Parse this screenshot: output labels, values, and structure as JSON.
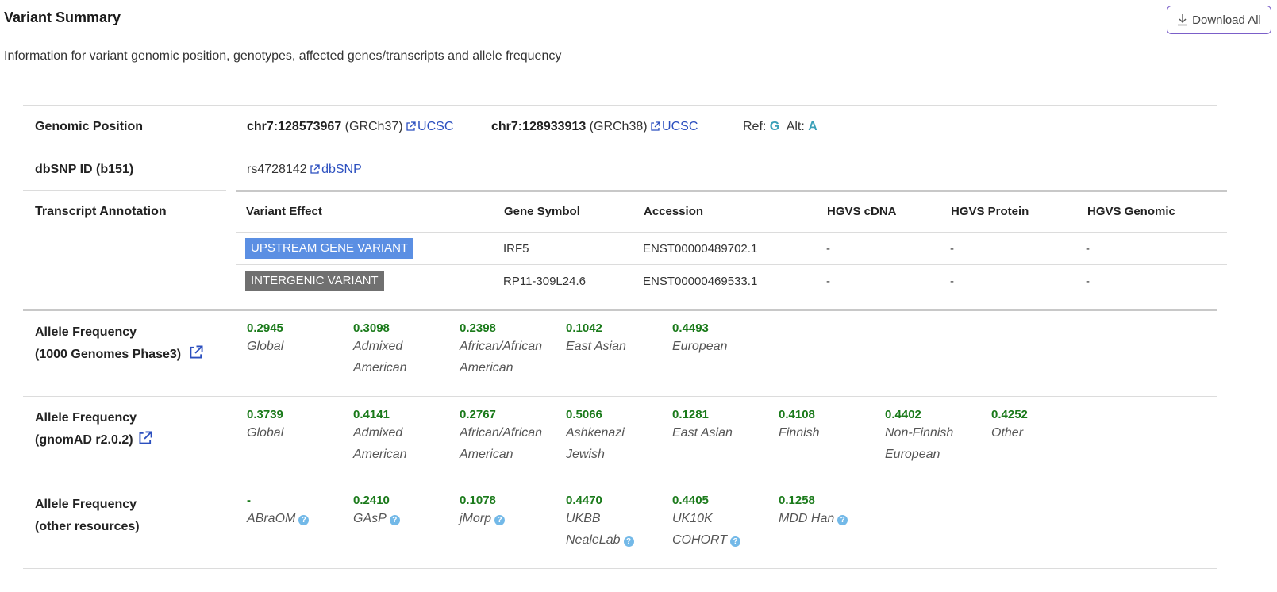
{
  "header": {
    "title": "Variant Summary",
    "subtitle": "Information for variant genomic position, genotypes, affected genes/transcripts and allele frequency",
    "download_label": "Download All"
  },
  "genomic_position": {
    "label": "Genomic Position",
    "grch37_pos": "chr7:128573967",
    "grch37_build": "(GRCh37)",
    "grch38_pos": "chr7:128933913",
    "grch38_build": "(GRCh38)",
    "ucsc_label": "UCSC",
    "ref_label": "Ref:",
    "ref": "G",
    "alt_label": "Alt:",
    "alt": "A"
  },
  "dbsnp": {
    "label": "dbSNP ID (b151)",
    "id": "rs4728142",
    "link_label": "dbSNP"
  },
  "transcript": {
    "label": "Transcript Annotation",
    "headers": [
      "Variant Effect",
      "Gene Symbol",
      "Accession",
      "HGVS cDNA",
      "HGVS Protein",
      "HGVS Genomic"
    ],
    "rows": [
      {
        "effect": "UPSTREAM GENE VARIANT",
        "gene": "IRF5",
        "accession": "ENST00000489702.1",
        "cdna": "-",
        "protein": "-",
        "genomic": "-",
        "color": "#5b8fe3"
      },
      {
        "effect": "INTERGENIC VARIANT",
        "gene": "RP11-309L24.6",
        "accession": "ENST00000469533.1",
        "cdna": "-",
        "protein": "-",
        "genomic": "-",
        "color": "#707070"
      }
    ]
  },
  "af_1000g": {
    "label_line1": "Allele Frequency",
    "label_line2": "(1000 Genomes Phase3)",
    "items": [
      {
        "value": "0.2945",
        "pop1": "Global",
        "pop2": ""
      },
      {
        "value": "0.3098",
        "pop1": "Admixed",
        "pop2": "American"
      },
      {
        "value": "0.2398",
        "pop1": "African/African",
        "pop2": "American"
      },
      {
        "value": "0.1042",
        "pop1": "East Asian",
        "pop2": ""
      },
      {
        "value": "0.4493",
        "pop1": "European",
        "pop2": ""
      }
    ]
  },
  "af_gnomad": {
    "label_line1": "Allele Frequency",
    "label_line2": "(gnomAD r2.0.2)",
    "items": [
      {
        "value": "0.3739",
        "pop1": "Global",
        "pop2": ""
      },
      {
        "value": "0.4141",
        "pop1": "Admixed",
        "pop2": "American"
      },
      {
        "value": "0.2767",
        "pop1": "African/African",
        "pop2": "American"
      },
      {
        "value": "0.5066",
        "pop1": "Ashkenazi",
        "pop2": "Jewish"
      },
      {
        "value": "0.1281",
        "pop1": "East Asian",
        "pop2": ""
      },
      {
        "value": "0.4108",
        "pop1": "Finnish",
        "pop2": ""
      },
      {
        "value": "0.4402",
        "pop1": "Non-Finnish",
        "pop2": "European"
      },
      {
        "value": "0.4252",
        "pop1": "Other",
        "pop2": ""
      }
    ]
  },
  "af_other": {
    "label_line1": "Allele Frequency",
    "label_line2": "(other resources)",
    "items": [
      {
        "value": "-",
        "pop1": "ABraOM",
        "pop2": "",
        "help_line": 1
      },
      {
        "value": "0.2410",
        "pop1": "GAsP",
        "pop2": "",
        "help_line": 1
      },
      {
        "value": "0.1078",
        "pop1": "jMorp",
        "pop2": "",
        "help_line": 1
      },
      {
        "value": "0.4470",
        "pop1": "UKBB",
        "pop2": "NealeLab",
        "help_line": 2
      },
      {
        "value": "0.4405",
        "pop1": "UK10K",
        "pop2": "COHORT",
        "help_line": 2
      },
      {
        "value": "0.1258",
        "pop1": "MDD Han",
        "pop2": "",
        "help_line": 1
      }
    ]
  },
  "colors": {
    "frequency": "#1a7a1a",
    "link": "#2b4fbf",
    "ref_alt": "#3aa0b8",
    "help_icon": "#73b9e8",
    "button_border": "#7b5fc9"
  }
}
